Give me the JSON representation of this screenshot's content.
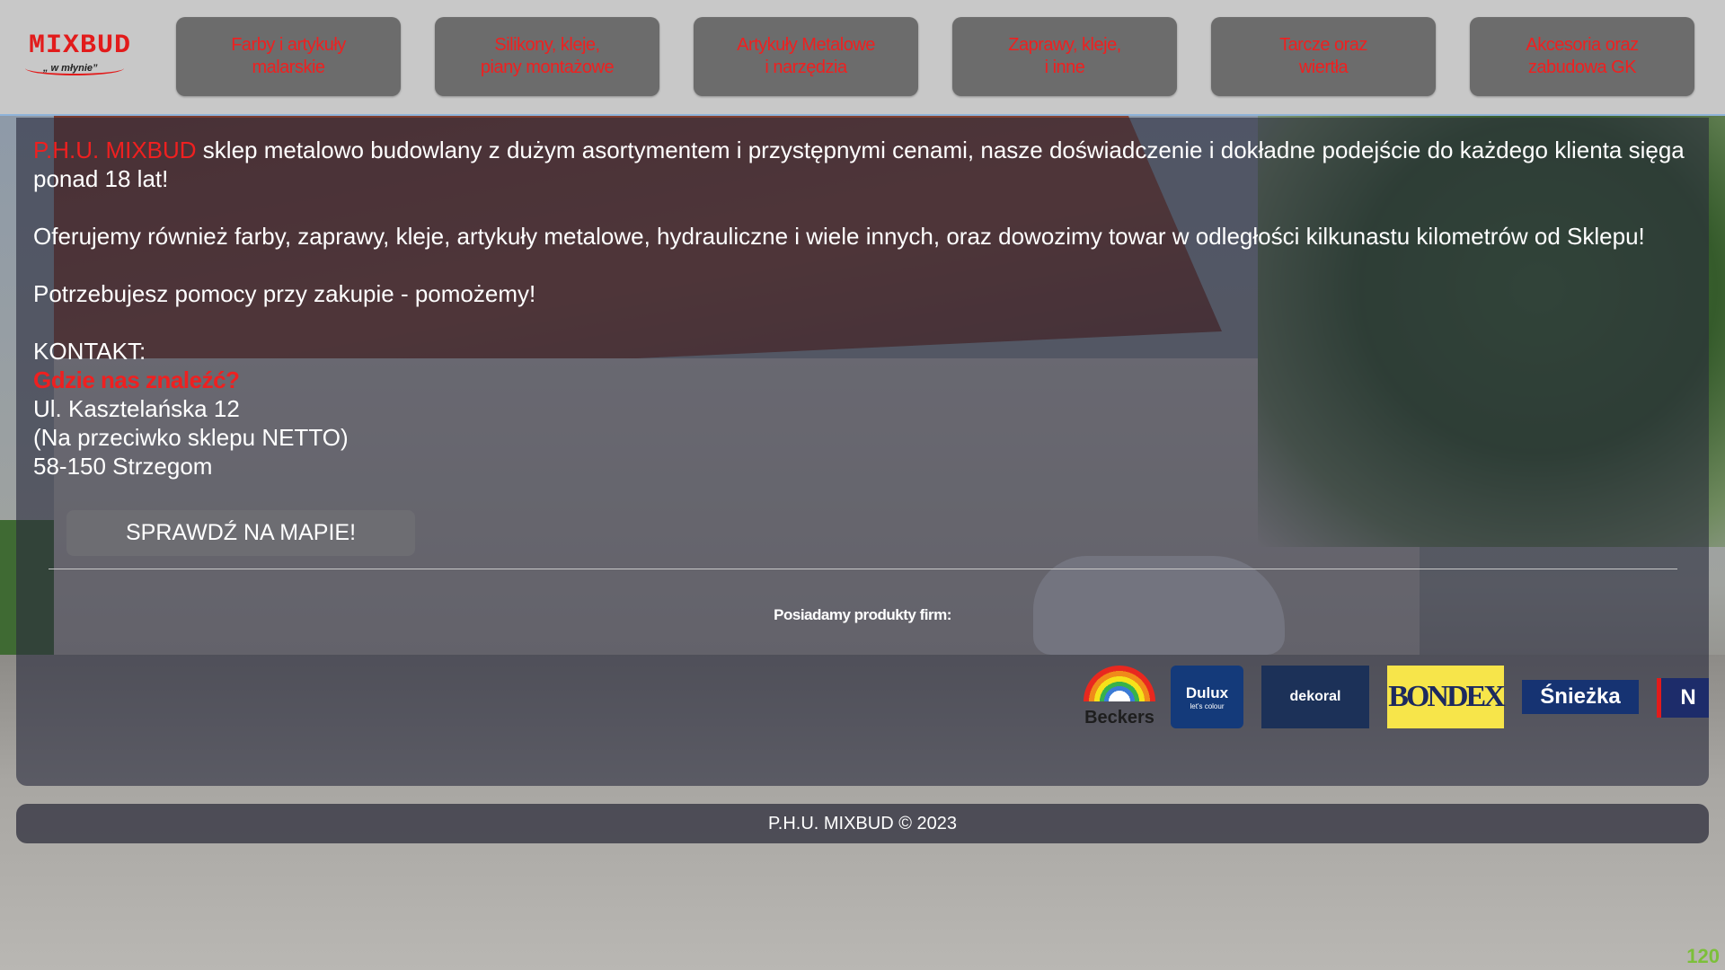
{
  "header": {
    "logo": {
      "name": "MIXBUD",
      "tagline": "„ w młynie”"
    },
    "nav": [
      {
        "label": "Farby i artykuły\nmalarskie"
      },
      {
        "label": "Silikony, kleje,\npiany montażowe"
      },
      {
        "label": "Artykuły Metalowe\ni narzędzia"
      },
      {
        "label": "Zaprawy, kleje,\ni inne"
      },
      {
        "label": "Tarcze oraz\nwiertła"
      },
      {
        "label": "Akcesoria oraz\nzabudowa GK"
      }
    ]
  },
  "main": {
    "brand": "P.H.U. MIXBUD",
    "intro_rest": " sklep metalowo budowlany z dużym asortymentem i przystępnymi cenami, nasze doświadczenie i dokładne podejście do każdego klienta sięga ponad 18 lat!",
    "offer": "Oferujemy również farby, zaprawy, kleje, artykuły metalowe, hydrauliczne i wiele innych, oraz dowozimy towar w odległości kilkunastu kilometrów od Sklepu!",
    "help": "Potrzebujesz pomocy przy zakupie - pomożemy!",
    "contact": {
      "heading": "KONTAKT:",
      "where": "Gdzie nas znaleźć?",
      "street": "Ul. Kasztelańska 12",
      "landmark": "(Na przeciwko sklepu NETTO)",
      "city": "58-150 Strzegom"
    },
    "map_button": "SPRAWDŹ NA MAPIE!",
    "firms_label": "Posiadamy produkty firm:",
    "brand_logos": [
      {
        "name": "Beckers",
        "color": "#e8281f"
      },
      {
        "name": "Dulux",
        "sub": "let's colour",
        "color": "#143a7a"
      },
      {
        "name": "dekoral",
        "color": "#1c3158"
      },
      {
        "name": "BONDEX",
        "color": "#f7e54a"
      },
      {
        "name": "Śnieżka",
        "color": "#163372"
      },
      {
        "name": "N",
        "color": "#1d2c6a"
      }
    ]
  },
  "footer": {
    "text": "P.H.U. MIXBUD © 2023"
  },
  "corner_counter": "120",
  "colors": {
    "accent": "#ef2020",
    "header_bg": "#c8c8c8",
    "nav_bg": "#6c6c6c"
  }
}
